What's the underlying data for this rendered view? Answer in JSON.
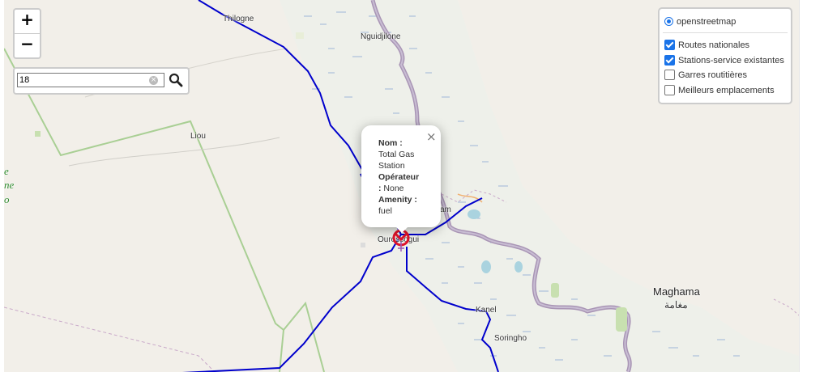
{
  "zoom": {
    "in_label": "+",
    "out_label": "−"
  },
  "search": {
    "value": "18",
    "clear_icon": "clear-icon",
    "button_icon": "search-icon"
  },
  "layers": {
    "base": {
      "label": "openstreetmap",
      "selected": true
    },
    "overlays": [
      {
        "label": "Routes nationales",
        "checked": true
      },
      {
        "label": "Stations-service existantes",
        "checked": true
      },
      {
        "label": "Garres routitières",
        "checked": false
      },
      {
        "label": "Meilleurs emplacements",
        "checked": false
      }
    ]
  },
  "popup": {
    "close": "×",
    "nom_key": "Nom :",
    "nom_value": "Total Gas Station",
    "operateur_key": "Opérateur",
    "operateur_sep": ":",
    "operateur_value": "None",
    "amenity_key": "Amenity :",
    "amenity_value": "fuel"
  },
  "places": {
    "thilogne": "Thilogne",
    "nguidjilone": "Nguidjilone",
    "liou": "Liou",
    "ourossogui": "Ourossogui",
    "kanel": "Kanel",
    "maghama": "Maghama",
    "maghama_ar": "مغامة",
    "soringho": "Soringho",
    "am": "am",
    "edge_1": "e",
    "edge_2": "ne",
    "edge_3": "o"
  },
  "colors": {
    "road": "#0000cc",
    "river": "#a995b5",
    "marker": "#e0142a",
    "accent": "#1a73e8"
  }
}
